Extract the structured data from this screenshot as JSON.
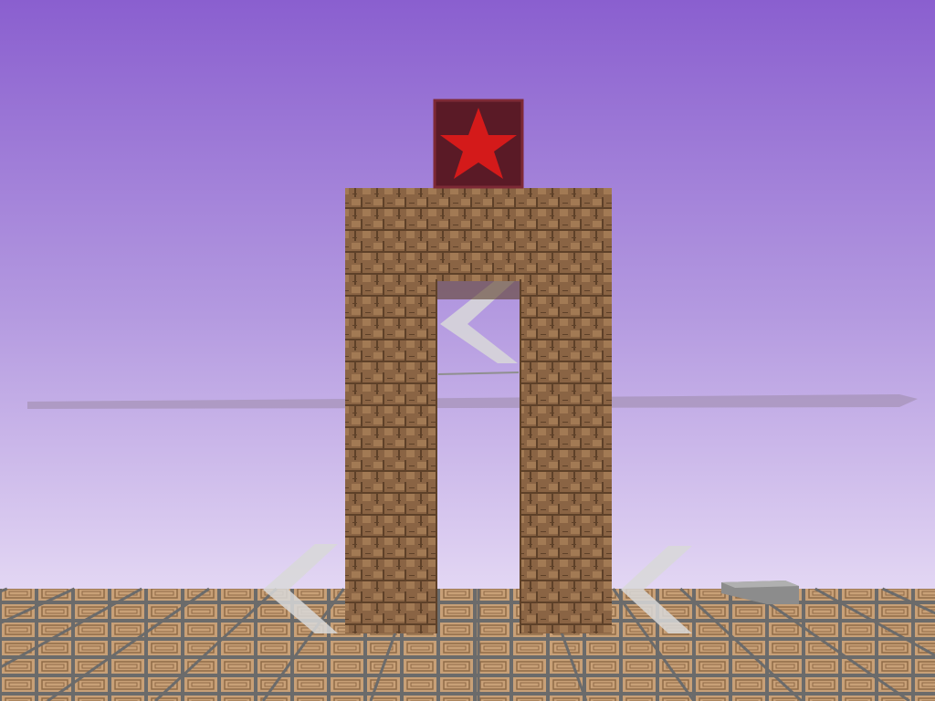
{
  "colors": {
    "sky_top": "#8a5fcf",
    "sky_mid": "#b49ae0",
    "sky_bottom": "#e4d8f4",
    "horizon_line": "#9c8aa8",
    "floor_tile": "#c8a077",
    "floor_tile_dark": "#8f6a47",
    "floor_grout": "#6b6b6b",
    "wood_plank": "#8a6444",
    "wood_dark": "#5e4129",
    "wood_light": "#a27a54",
    "star_block_bg": "#5a1a26",
    "star_block_border": "#7e2a36",
    "star_fill": "#d41a1a",
    "chevron": "#d8d8d8",
    "stone_block": "#8c8c8c"
  },
  "objects": {
    "goal_block_icon": "red-star-icon",
    "arch": "wooden-plank-archway",
    "chevrons": [
      "left-chevron-icon",
      "left-chevron-icon",
      "left-chevron-icon"
    ]
  }
}
